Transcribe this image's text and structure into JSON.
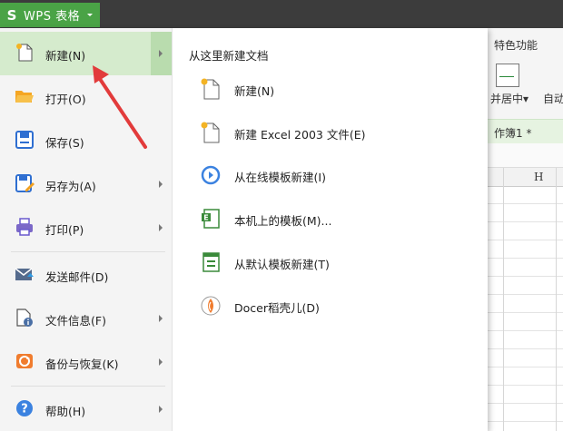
{
  "app": {
    "title": "WPS 表格",
    "logo_char": "S"
  },
  "background": {
    "feature_tab": "特色功能",
    "merge_label": "并居中▾",
    "auto_label": "自动",
    "sheet_tab": "作簿1 *",
    "column_header": "H"
  },
  "menu": {
    "items": [
      {
        "label": "新建(N)",
        "icon": "new-file-icon",
        "has_submenu": true,
        "active": true
      },
      {
        "label": "打开(O)",
        "icon": "folder-open-icon",
        "has_submenu": false
      },
      {
        "label": "保存(S)",
        "icon": "save-icon",
        "has_submenu": false
      },
      {
        "label": "另存为(A)",
        "icon": "save-as-icon",
        "has_submenu": true
      },
      {
        "label": "打印(P)",
        "icon": "print-icon",
        "has_submenu": true
      },
      {
        "label": "发送邮件(D)",
        "icon": "mail-icon",
        "has_submenu": false
      },
      {
        "label": "文件信息(F)",
        "icon": "file-info-icon",
        "has_submenu": true
      },
      {
        "label": "备份与恢复(K)",
        "icon": "backup-icon",
        "has_submenu": true
      },
      {
        "label": "帮助(H)",
        "icon": "help-icon",
        "has_submenu": true
      }
    ],
    "submenu_title": "从这里新建文档",
    "submenu": [
      {
        "label": "新建(N)",
        "icon": "new-file-icon"
      },
      {
        "label": "新建 Excel 2003 文件(E)",
        "icon": "new-file-icon"
      },
      {
        "label": "从在线模板新建(I)",
        "icon": "online-template-icon"
      },
      {
        "label": "本机上的模板(M)...",
        "icon": "local-template-icon"
      },
      {
        "label": "从默认模板新建(T)",
        "icon": "default-template-icon"
      },
      {
        "label": "Docer稻壳儿(D)",
        "icon": "docer-icon"
      }
    ]
  },
  "colors": {
    "accent_green": "#4aa346",
    "active_item": "#d5ebcd",
    "annotation_red": "#e23b3b"
  }
}
